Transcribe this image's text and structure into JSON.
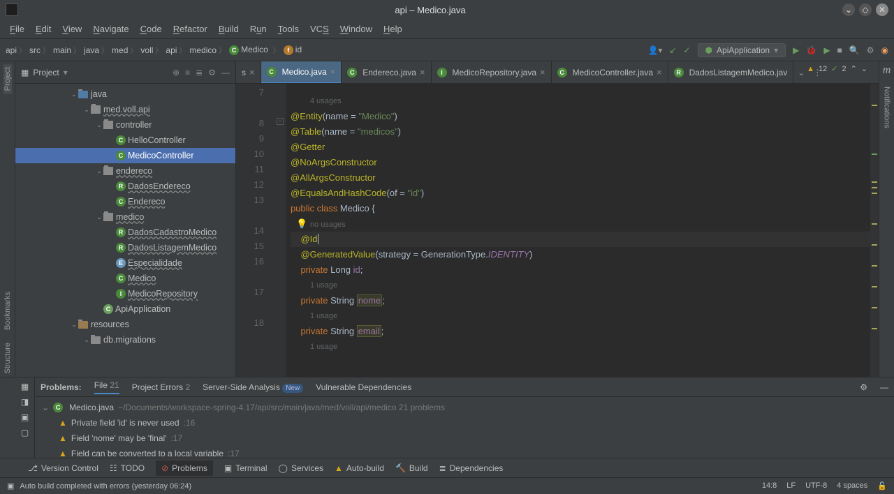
{
  "titlebar": {
    "title": "api – Medico.java"
  },
  "menu": [
    "File",
    "Edit",
    "View",
    "Navigate",
    "Code",
    "Refactor",
    "Build",
    "Run",
    "Tools",
    "VCS",
    "Window",
    "Help"
  ],
  "breadcrumb": [
    "api",
    "src",
    "main",
    "java",
    "med",
    "voll",
    "api",
    "medico"
  ],
  "breadcrumb_class": "Medico",
  "breadcrumb_field": "id",
  "run_config": "ApiApplication",
  "project_label": "Project",
  "tree": {
    "java": "java",
    "pkg": "med.voll.api",
    "controller": "controller",
    "hello": "HelloController",
    "medicoctrl": "MedicoController",
    "endereco_pkg": "endereco",
    "dadosendereco": "DadosEndereco",
    "endereco": "Endereco",
    "medico_pkg": "medico",
    "dadoscad": "DadosCadastroMedico",
    "dadoslist": "DadosListagemMedico",
    "esp": "Especialidade",
    "medico": "Medico",
    "medrepo": "MedicoRepository",
    "apiapp": "ApiApplication",
    "resources": "resources",
    "dbmig": "db.migrations"
  },
  "tabs": [
    {
      "label": "s",
      "icon": "C",
      "active": false,
      "close": true
    },
    {
      "label": "Medico.java",
      "icon": "C",
      "active": true,
      "close": true
    },
    {
      "label": "Endereco.java",
      "icon": "C",
      "active": false,
      "close": true
    },
    {
      "label": "MedicoRepository.java",
      "icon": "I",
      "active": false,
      "close": true
    },
    {
      "label": "MedicoController.java",
      "icon": "C",
      "active": false,
      "close": true
    },
    {
      "label": "DadosListagemMedico.jav",
      "icon": "R",
      "active": false,
      "close": false
    }
  ],
  "inspections": {
    "warn": "12",
    "ok": "2"
  },
  "code": {
    "usages4": "4 usages",
    "l7": {
      "n": "7",
      "a": "@Entity",
      "p1": "(name = ",
      "s": "\"Medico\"",
      "p2": ")"
    },
    "l8": {
      "n": "8",
      "a": "@Table",
      "p1": "(name = ",
      "s": "\"medicos\"",
      "p2": ")"
    },
    "l9": {
      "n": "9",
      "a": "@Getter"
    },
    "l10": {
      "n": "10",
      "a": "@NoArgsConstructor"
    },
    "l11": {
      "n": "11",
      "a": "@AllArgsConstructor"
    },
    "l12": {
      "n": "12",
      "a": "@EqualsAndHashCode",
      "p1": "(of = ",
      "s": "\"id\"",
      "p2": ")"
    },
    "l13": {
      "n": "13",
      "kw1": "public",
      "kw2": "class",
      "cls": "Medico",
      "br": " {"
    },
    "nousages": "no usages",
    "l14": {
      "n": "14",
      "a": "@Id"
    },
    "l15": {
      "n": "15",
      "a": "@GeneratedValue",
      "p1": "(strategy = GenerationType.",
      "id": "IDENTITY",
      "p2": ")"
    },
    "l16": {
      "n": "16",
      "kw": "private",
      "typ": "Long",
      "f": "id",
      "sc": ";"
    },
    "usage1a": "1 usage",
    "l17": {
      "n": "17",
      "kw": "private",
      "typ": "String",
      "f": "nome",
      "sc": ";"
    },
    "usage1b": "1 usage",
    "l18": {
      "n": "18",
      "kw": "private",
      "typ": "String",
      "f": "email",
      "sc": ";"
    },
    "usage1c": "1 usage"
  },
  "problems": {
    "header": "Problems:",
    "file_tab": "File",
    "file_count": "21",
    "pe_tab": "Project Errors",
    "pe_count": "2",
    "ssa": "Server-Side Analysis",
    "new": "New",
    "vuln": "Vulnerable Dependencies",
    "file_name": "Medico.java",
    "file_path": "~/Documents/workspace-spring-4.17/api/src/main/java/med/voll/api/medico  21 problems",
    "p1": "Private field 'id' is never used",
    "p1l": ":16",
    "p2": "Field 'nome' may be 'final'",
    "p2l": ":17",
    "p3": "Field can be converted to a local variable",
    "p3l": ":17"
  },
  "bottom": {
    "vc": "Version Control",
    "todo": "TODO",
    "prob": "Problems",
    "term": "Terminal",
    "svc": "Services",
    "auto": "Auto-build",
    "build": "Build",
    "deps": "Dependencies"
  },
  "status": {
    "msg": "Auto build completed with errors (yesterday 06:24)",
    "pos": "14:8",
    "lf": "LF",
    "enc": "UTF-8",
    "indent": "4 spaces"
  },
  "left_rail": {
    "proj": "Project",
    "bm": "Bookmarks",
    "struct": "Structure"
  },
  "right_rail": {
    "maven": "m",
    "notif": "Notifications"
  }
}
